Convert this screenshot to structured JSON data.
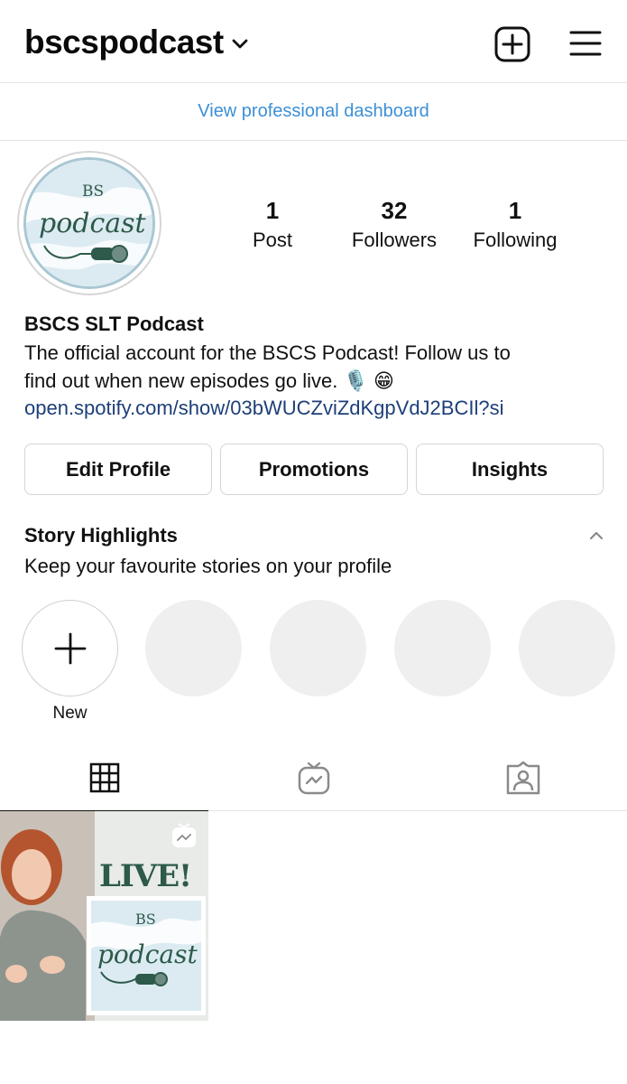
{
  "header": {
    "username": "bscspodcast",
    "icons": [
      "chevron-down-icon",
      "new-post-icon",
      "menu-icon"
    ]
  },
  "dashboard": {
    "label": "View professional dashboard",
    "color": "#3d8fd6"
  },
  "stats": [
    {
      "num": "1",
      "label": "Post"
    },
    {
      "num": "32",
      "label": "Followers"
    },
    {
      "num": "1",
      "label": "Following"
    }
  ],
  "bio": {
    "name": "BSCS SLT Podcast",
    "line1": "The official account for the BSCS Podcast! Follow us to",
    "line2": "find out when new episodes go live. 🎙️ 😁",
    "link": "open.spotify.com/show/03bWUCZviZdKgpVdJ2BCIl?si",
    "link_color": "#1d3f78"
  },
  "buttons": {
    "edit": "Edit Profile",
    "promotions": "Promotions",
    "insights": "Insights"
  },
  "highlights": {
    "title": "Story Highlights",
    "subtitle": "Keep your favourite stories on your profile",
    "new_label": "New"
  },
  "avatar": {
    "top_text": "BS",
    "script_text": "podcast"
  },
  "post": {
    "live_text": "LIVE!",
    "badge": "igtv-icon"
  },
  "tabs": [
    "grid-icon",
    "igtv-icon",
    "tagged-icon"
  ]
}
